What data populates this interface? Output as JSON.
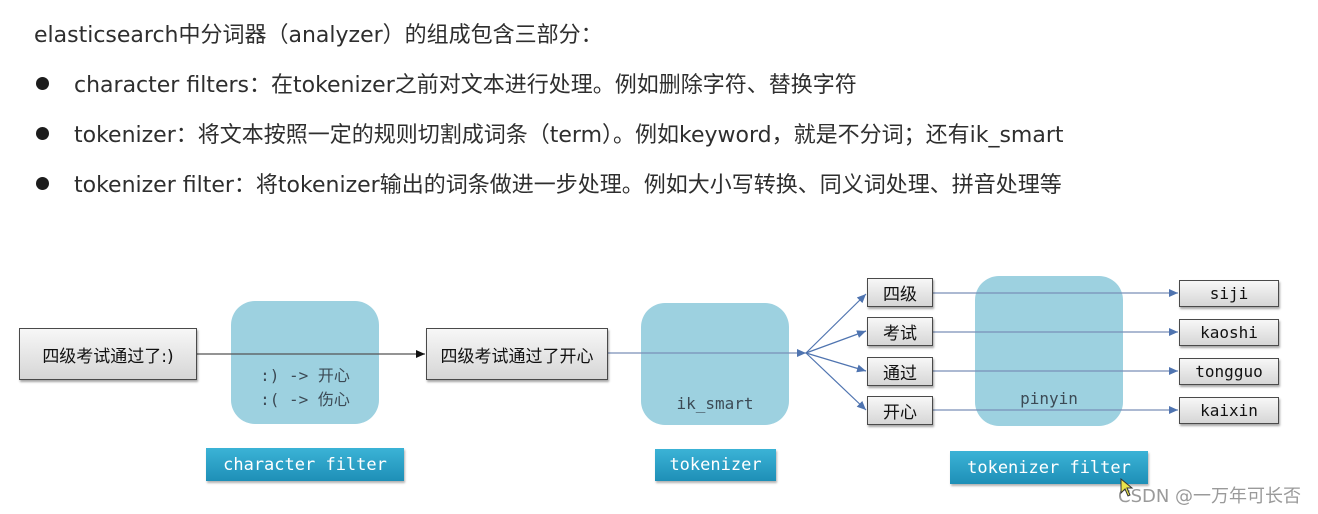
{
  "intro": "elasticsearch中分词器（analyzer）的组成包含三部分：",
  "bullets": [
    {
      "text": "character filters：在tokenizer之前对文本进行处理。例如删除字符、替换字符"
    },
    {
      "text": "tokenizer：将文本按照一定的规则切割成词条（term）。例如keyword，就是不分词；还有ik_smart"
    },
    {
      "text": "tokenizer filter：将tokenizer输出的词条做进一步处理。例如大小写转换、同义词处理、拼音处理等"
    }
  ],
  "diagram": {
    "input_text": "四级考试通过了:)",
    "char_filter": {
      "rules": [
        ":) -> 开心",
        ":( -> 伤心"
      ],
      "label": "character filter"
    },
    "filtered_text": "四级考试通过了开心",
    "tokenizer": {
      "name": "ik_smart",
      "label": "tokenizer"
    },
    "tokens": [
      "四级",
      "考试",
      "通过",
      "开心"
    ],
    "token_filter": {
      "name": "pinyin",
      "label": "tokenizer filter"
    },
    "outputs": [
      "siji",
      "kaoshi",
      "tongguo",
      "kaixin"
    ],
    "colors": {
      "panel": "#8cc9db",
      "label_bg": "#2aa3c9",
      "arrow": "#4f74b0",
      "line": "#7a8fb8"
    }
  },
  "watermark": "CSDN @一万年可长否"
}
